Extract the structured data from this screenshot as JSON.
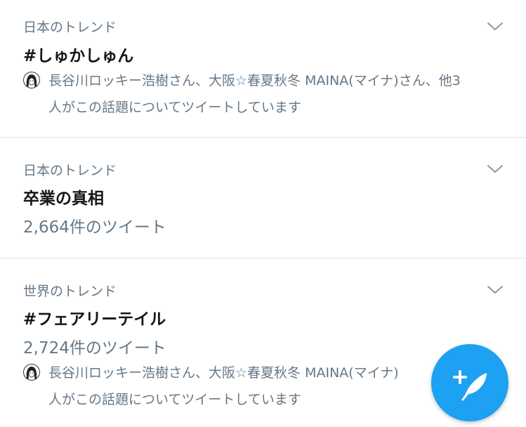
{
  "trends": [
    {
      "context": "日本のトレンド",
      "title": "#しゅかしゅん",
      "social_line1": "長谷川ロッキー浩樹さん、大阪☆春夏秋冬 MAINA(マイナ)さん、他3",
      "social_line2": "人がこの話題についてツイートしています"
    },
    {
      "context": "日本のトレンド",
      "title": "卒業の真相",
      "count": "2,664件のツイート"
    },
    {
      "context": "世界のトレンド",
      "title": "#フェアリーテイル",
      "count": "2,724件のツイート",
      "social_line1": "長谷川ロッキー浩樹さん、大阪☆春夏秋冬 MAINA(マイナ)",
      "social_line2": "人がこの話題についてツイートしています"
    }
  ],
  "icons": {
    "more": "chevron-down-icon",
    "avatar": "avatar-icon",
    "compose": "compose-tweet-icon"
  },
  "colors": {
    "accent": "#1da1f2",
    "secondary_text": "#657786",
    "primary_text": "#14171a",
    "divider": "#dfe3e6"
  }
}
